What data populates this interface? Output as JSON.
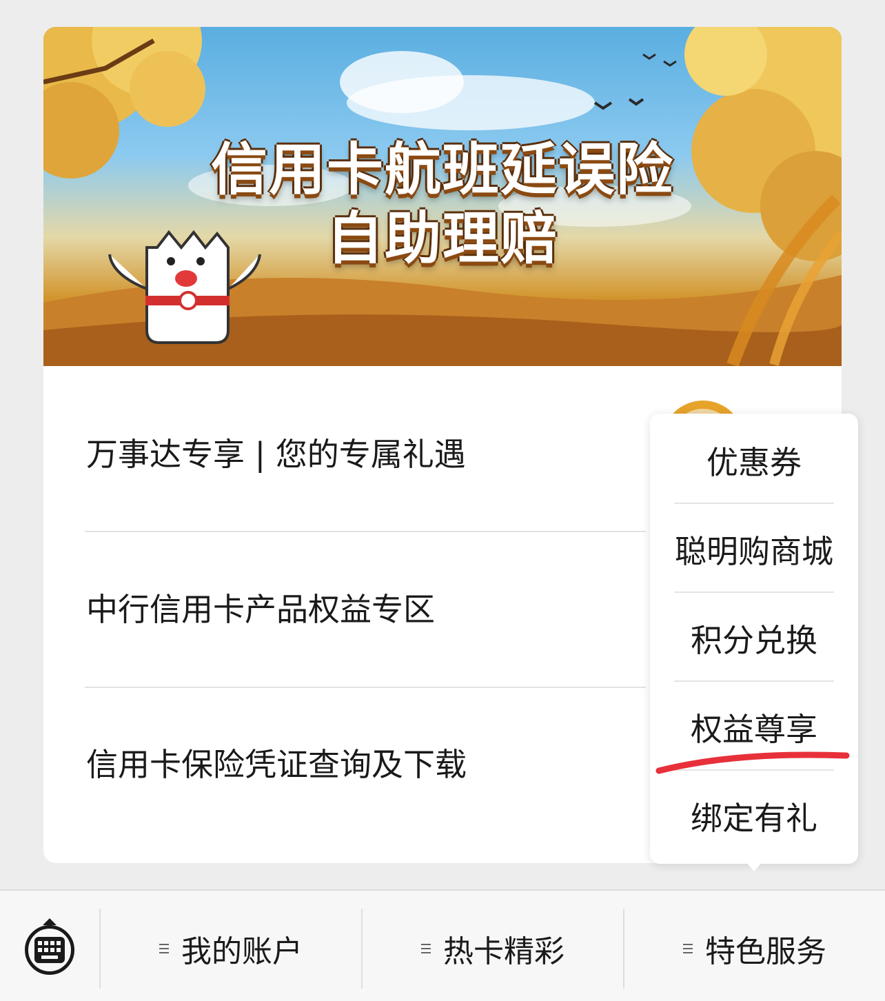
{
  "banner": {
    "title_line1": "信用卡航班延误险",
    "title_line2": "自助理赔"
  },
  "list": {
    "items": [
      {
        "label": "万事达专享 | 您的专属礼遇"
      },
      {
        "label": "中行信用卡产品权益专区"
      },
      {
        "label": "信用卡保险凭证查询及下载"
      }
    ]
  },
  "popup_menu": {
    "items": [
      {
        "label": "优惠券"
      },
      {
        "label": "聪明购商城"
      },
      {
        "label": "积分兑换"
      },
      {
        "label": "权益尊享"
      },
      {
        "label": "绑定有礼"
      }
    ],
    "highlighted": "权益尊享",
    "highlight_color": "#e8303a"
  },
  "tabbar": {
    "keyboard_icon": "keyboard-icon",
    "tabs": [
      {
        "label": "我的账户",
        "icon": "menu-lines-icon"
      },
      {
        "label": "热卡精彩",
        "icon": "menu-lines-icon"
      },
      {
        "label": "特色服务",
        "icon": "menu-lines-icon"
      }
    ]
  }
}
